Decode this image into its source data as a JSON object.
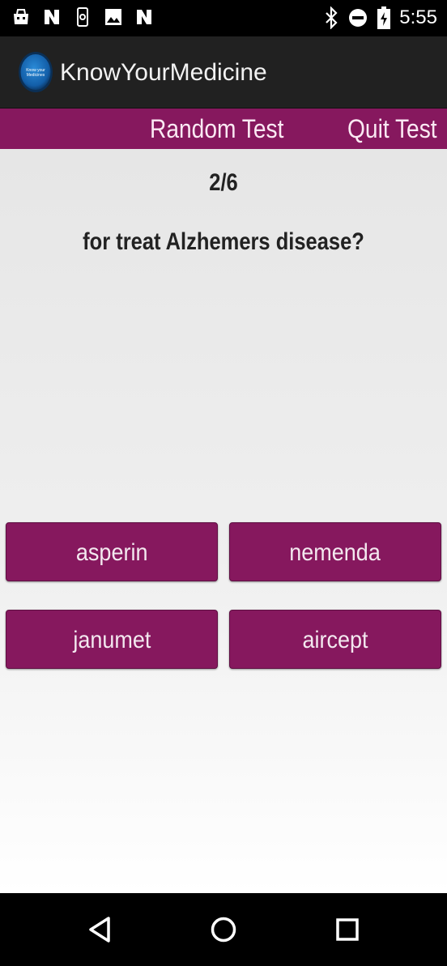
{
  "status_bar": {
    "time": "5:55",
    "left_icons": [
      "bag-icon",
      "n-icon",
      "phone-sync-icon",
      "image-icon",
      "n-icon"
    ],
    "right_icons": [
      "bluetooth-icon",
      "do-not-disturb-icon",
      "battery-charging-icon"
    ]
  },
  "app_bar": {
    "title": "KnowYourMedicine",
    "logo_text": "Know your Medicines"
  },
  "actions": {
    "random_test": "Random Test",
    "quit_test": "Quit Test"
  },
  "quiz": {
    "progress": "2/6",
    "question": "for treat Alzhemers disease?",
    "answers": [
      "asperin",
      "nemenda",
      "janumet",
      "aircept"
    ]
  },
  "colors": {
    "accent": "#86185e",
    "app_bar": "#212121",
    "background": "#e9e9e9"
  },
  "nav_bar": {
    "icons": [
      "back-icon",
      "home-icon",
      "recents-icon"
    ]
  }
}
